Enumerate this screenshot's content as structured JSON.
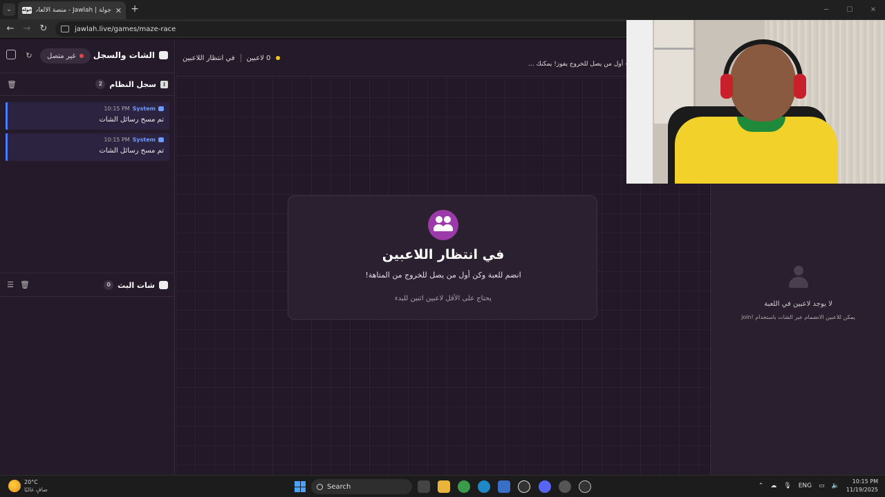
{
  "browser": {
    "tab_title": "جولة | Jawlah - منصة الألعاب الت...",
    "favicon_text": "جولة",
    "url": "jawlah.live/games/maze-race"
  },
  "sidebar": {
    "title": "الشات والسجل",
    "status_label": "غير متصل",
    "system_log": {
      "title": "سجل النظام",
      "count": "2",
      "messages": [
        {
          "sender": "System",
          "time": "10:15 PM",
          "text": "تم مسح رسائل الشات"
        },
        {
          "sender": "System",
          "time": "10:15 PM",
          "text": "تم مسح رسائل الشات"
        }
      ]
    },
    "stream_chat": {
      "title": "شات البث",
      "count": "0"
    }
  },
  "game": {
    "players_count": "0 لاعبين",
    "status": "في انتظار اللاعبين",
    "ticker": "- أول من يصل للخروج يفوز! يمكنك ...",
    "wait_title": "في انتظار اللاعبين",
    "wait_subtitle": "انضم للعبة وكن أول من يصل للخروج من المتاهة!",
    "wait_hint": "يحتاج على الأقل لاعبين اثنين للبدء"
  },
  "players_panel": {
    "empty_title": "لا يوجد لاعبين في اللعبة",
    "empty_hint": "يمكن للاعبين الانضمام عبر الشات باستخدام !join"
  },
  "taskbar": {
    "temperature": "20°C",
    "weather_desc": "صافٍ غالبًا",
    "search_label": "Search",
    "language": "ENG",
    "time": "10:15 PM",
    "date": "11/19/2025"
  },
  "colors": {
    "accent": "#9b3aa8",
    "system_sender": "#6d9bff",
    "offline_dot": "#e04848",
    "players_dot": "#f5c518"
  }
}
